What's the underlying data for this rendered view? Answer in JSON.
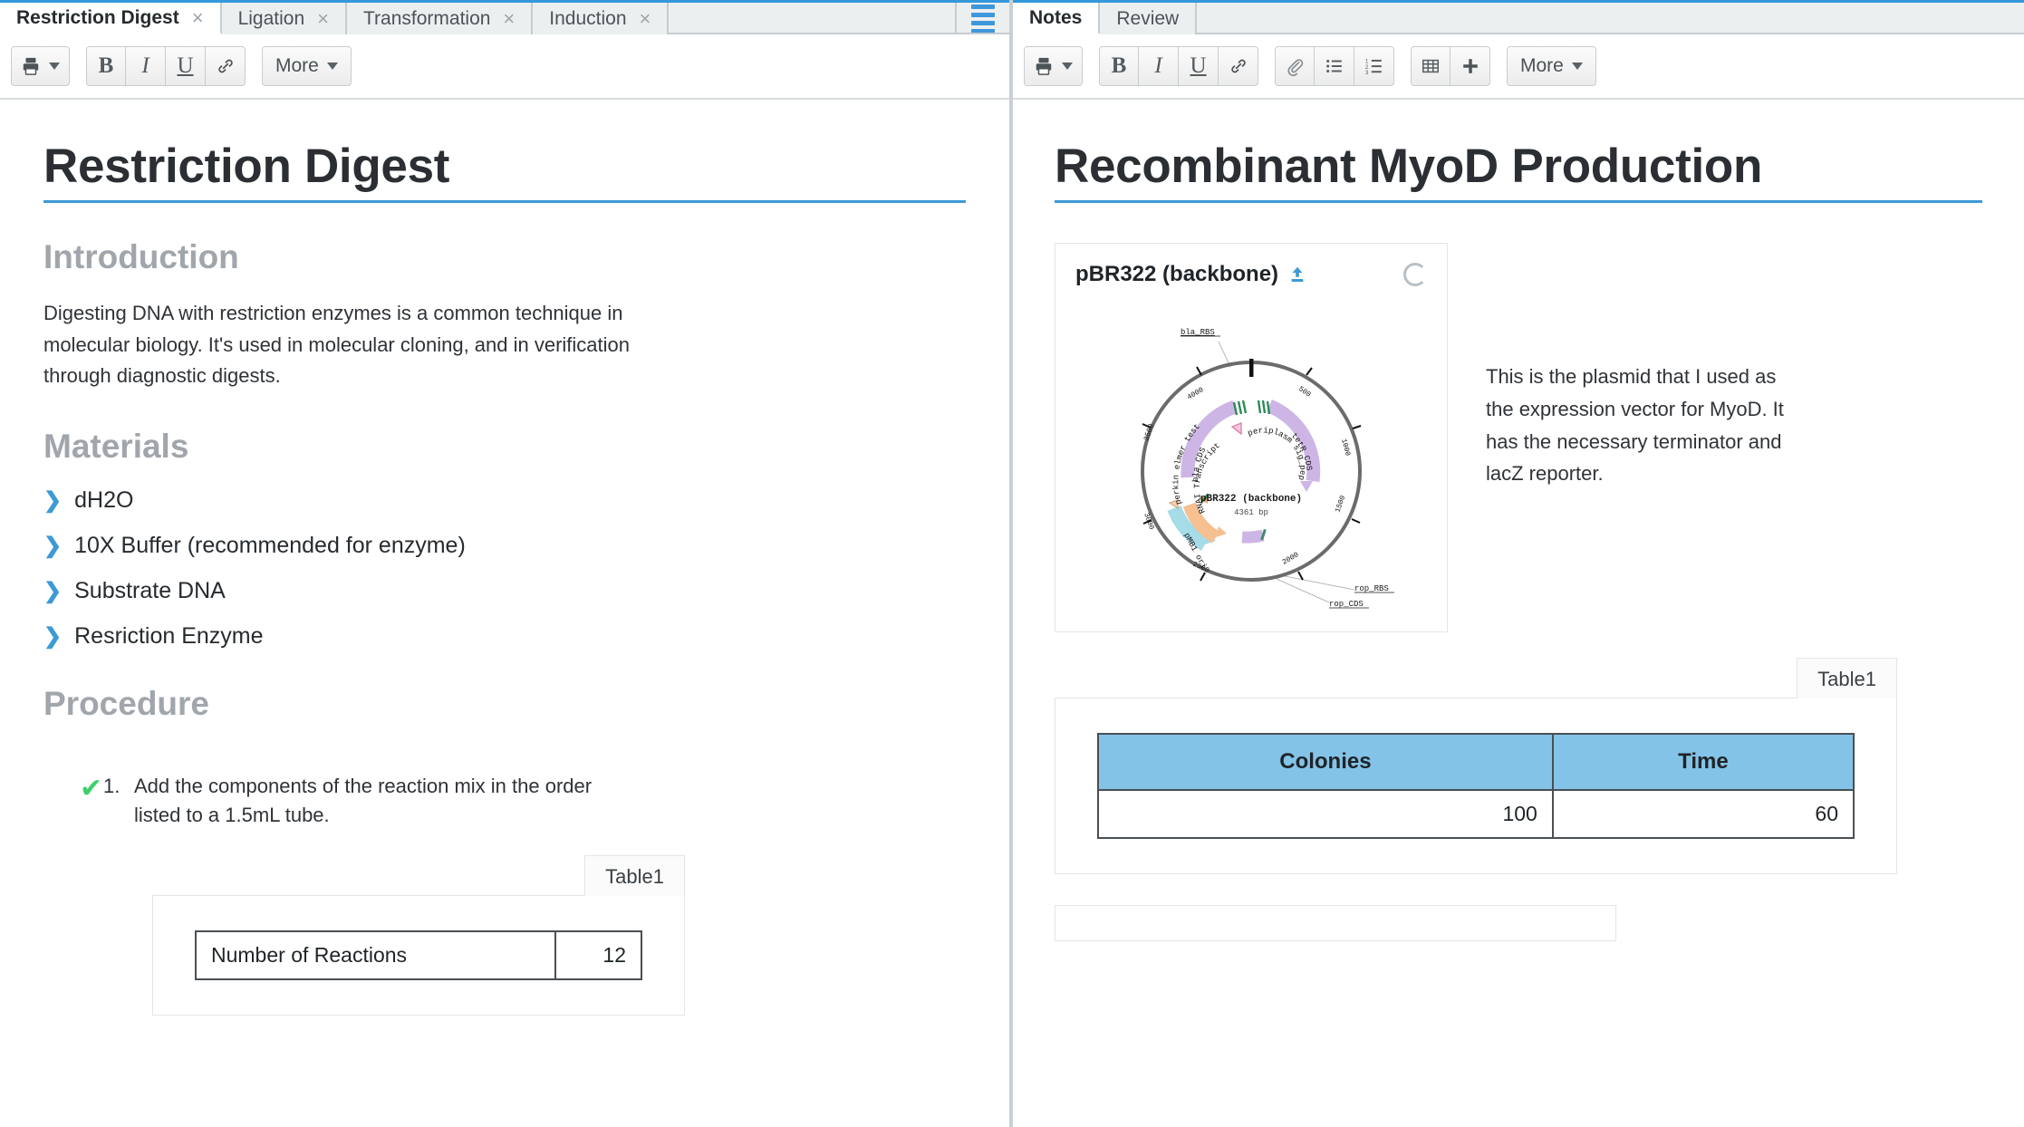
{
  "window": {
    "accent_color": "#3498db",
    "hamburger_color": "#3f97db"
  },
  "left_panel": {
    "tabs": [
      {
        "label": "Restriction Digest",
        "close": "×",
        "active": true
      },
      {
        "label": "Ligation",
        "close": "×",
        "active": false
      },
      {
        "label": "Transformation",
        "close": "×",
        "active": false
      },
      {
        "label": "Induction",
        "close": "×",
        "active": false
      }
    ],
    "menu_icon": "hamburger-icon",
    "toolbar": {
      "print_icon": "printer-icon",
      "bold_label": "B",
      "italic_label": "I",
      "underline_label": "U",
      "link_icon": "link-icon",
      "more_label": "More"
    },
    "document": {
      "title": "Restriction Digest",
      "sections": [
        {
          "heading": "Introduction"
        },
        {
          "heading": "Materials"
        },
        {
          "heading": "Procedure"
        }
      ],
      "intro_paragraph": "Digesting DNA with restriction enzymes is a common technique in molecular biology. It's used in molecular cloning, and in verification through diagnostic digests.",
      "materials": [
        "dH2O",
        "10X Buffer (recommended for enzyme)",
        "Substrate DNA",
        "Resriction Enzyme"
      ],
      "procedure": [
        {
          "checked": true,
          "check_glyph": "✔",
          "number": "1.",
          "text": "Add the components of the reaction mix in the order listed to a 1.5mL tube."
        }
      ],
      "table": {
        "tab_label": "Table1",
        "rows": [
          {
            "label": "Number of Reactions",
            "value": "12"
          }
        ]
      }
    }
  },
  "right_panel": {
    "tabs": [
      {
        "label": "Notes",
        "active": true
      },
      {
        "label": "Review",
        "active": false
      }
    ],
    "toolbar": {
      "print_icon": "printer-icon",
      "bold_label": "B",
      "italic_label": "I",
      "underline_label": "U",
      "link_icon": "link-icon",
      "attachment_icon": "paperclip-icon",
      "bullet_list_icon": "bullet-list-icon",
      "numbered_list_icon": "numbered-list-icon",
      "table_icon": "table-icon",
      "add_icon": "plus-icon",
      "more_label": "More"
    },
    "document": {
      "title": "Recombinant MyoD Production",
      "plasmid_card": {
        "name": "pBR322 (backbone)",
        "upload_icon": "upload-icon",
        "status_icon": "loading-spinner-icon",
        "map": {
          "center_name": "pBR322 (backbone)",
          "center_size": "4361 bp",
          "outer_labels": [
            "bla_RBS",
            "rop_RBS",
            "rop_CDS"
          ],
          "feature_labels": [
            "bla CDS",
            "tetR CDS",
            "perkin elmer test",
            "periplasm sig_peptide",
            "RNAI Transcript",
            "pMB1 ori"
          ],
          "ticks": [
            "500",
            "1000",
            "1500",
            "2000",
            "2500",
            "3000",
            "3500",
            "4000"
          ]
        }
      },
      "note_text": "This is the plasmid that I used as the expression vector for MyoD. It has the necessary terminator and lacZ reporter.",
      "table": {
        "tab_label": "Table1",
        "headers": [
          "Colonies",
          "Time"
        ],
        "rows": [
          [
            "100",
            "60"
          ]
        ]
      }
    }
  }
}
